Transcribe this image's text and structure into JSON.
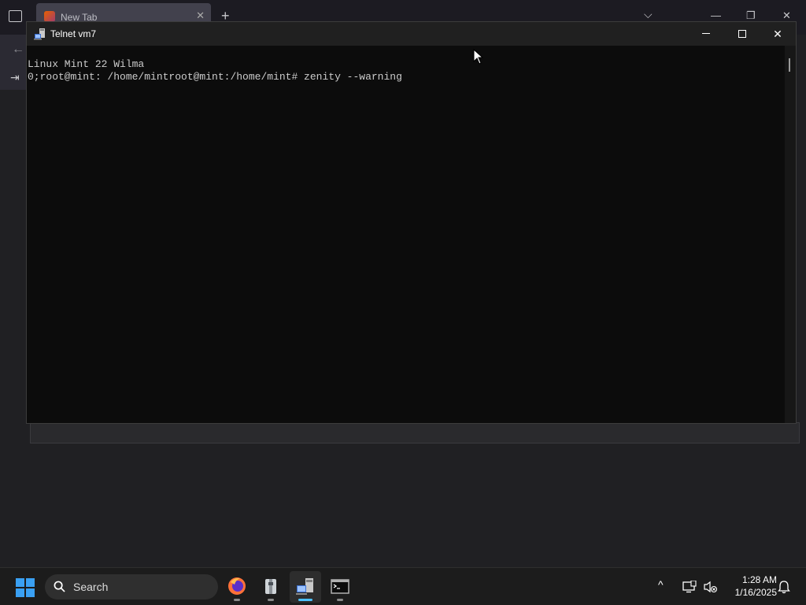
{
  "browser": {
    "tab_title": "New Tab",
    "tab_close": "✕",
    "new_tab": "+",
    "tab_list": "⌵",
    "win_min": "—",
    "win_restore": "❐",
    "win_close": "✕",
    "back": "←",
    "sign_in": "⇥"
  },
  "telnet": {
    "title": "Telnet vm7",
    "lines": [
      "Linux Mint 22 Wilma",
      "0;root@mint: /home/mintroot@mint:/home/mint# zenity --warning"
    ],
    "close_glyph": "✕"
  },
  "taskbar": {
    "search_label": "Search",
    "apps": [
      "firefox-icon",
      "archive-manager-icon",
      "telnet-icon",
      "terminal-icon"
    ],
    "tray_chevron": "^",
    "time": "1:28 AM",
    "date": "1/16/2025"
  },
  "colors": {
    "accent": "#4cc2ff",
    "start": "#3aa0f3",
    "terminal_bg": "#0c0c0c",
    "terminal_fg": "#cccccc"
  }
}
